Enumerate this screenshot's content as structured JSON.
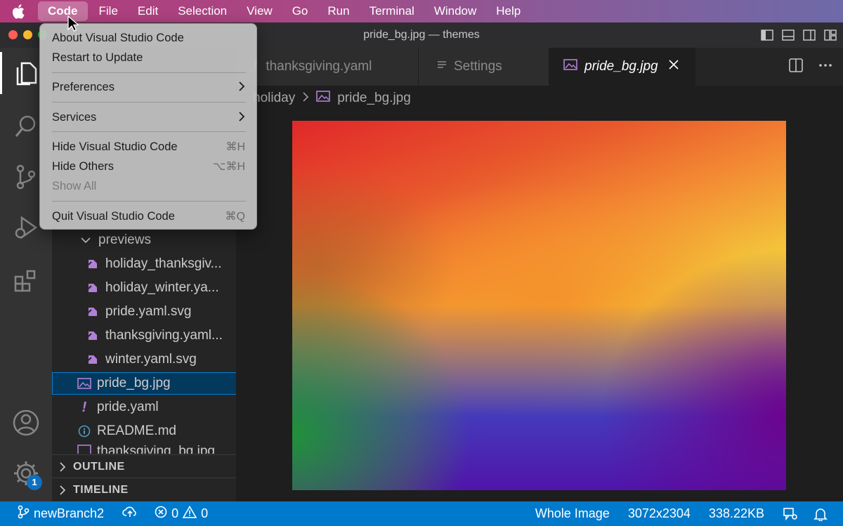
{
  "menubar": {
    "items": [
      "Code",
      "File",
      "Edit",
      "Selection",
      "View",
      "Go",
      "Run",
      "Terminal",
      "Window",
      "Help"
    ],
    "active": "Code"
  },
  "window": {
    "title": "pride_bg.jpg — themes"
  },
  "code_menu": {
    "about": "About Visual Studio Code",
    "restart": "Restart to Update",
    "preferences": "Preferences",
    "services": "Services",
    "hide": "Hide Visual Studio Code",
    "hide_shortcut": "⌘H",
    "hide_others": "Hide Others",
    "hide_others_shortcut": "⌥⌘H",
    "show_all": "Show All",
    "quit": "Quit Visual Studio Code",
    "quit_shortcut": "⌘Q"
  },
  "tabs": {
    "tab1": "thanksgiving.yaml",
    "tab2": "Settings",
    "tab3": "pride_bg.jpg"
  },
  "breadcrumb": {
    "folder": "holiday",
    "file": "pride_bg.jpg"
  },
  "explorer": {
    "previews_folder": "previews",
    "items": [
      "holiday_thanksgiv...",
      "holiday_winter.ya...",
      "pride.yaml.svg",
      "thanksgiving.yaml...",
      "winter.yaml.svg"
    ],
    "pride_bg": "pride_bg.jpg",
    "pride_yaml": "pride.yaml",
    "readme": "README.md",
    "thanksgiving_bg": "thanksgiving_bg.jpg",
    "outline": "OUTLINE",
    "timeline": "TIMELINE"
  },
  "activity": {
    "settings_badge": "1"
  },
  "status": {
    "branch": "newBranch2",
    "errors": "0",
    "warnings": "0",
    "whole_image": "Whole Image",
    "dimensions": "3072x2304",
    "size": "338.22KB"
  },
  "colors": {
    "statusbar": "#007acc",
    "selection": "#04395e",
    "accent_purple": "#b180d7"
  }
}
